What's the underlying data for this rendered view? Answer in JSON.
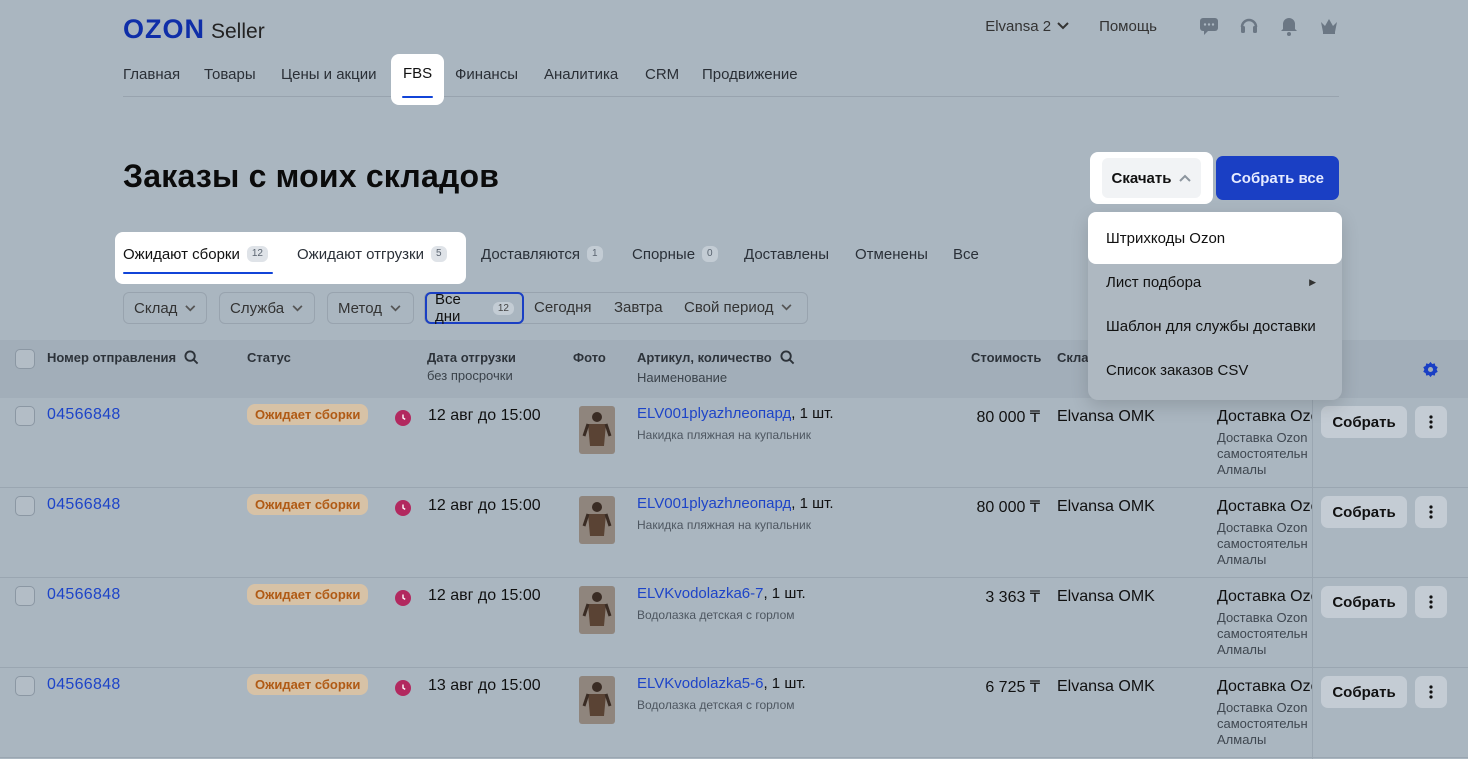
{
  "header": {
    "brand": "OZON",
    "product": "Seller",
    "account": "Elvansa 2",
    "help": "Помощь",
    "icons": [
      "chat-icon",
      "headset-icon",
      "bell-icon",
      "crown-icon"
    ]
  },
  "nav": {
    "items": [
      {
        "label": "Главная"
      },
      {
        "label": "Товары"
      },
      {
        "label": "Цены и акции"
      },
      {
        "label": "FBS",
        "active": true
      },
      {
        "label": "Финансы"
      },
      {
        "label": "Аналитика"
      },
      {
        "label": "CRM"
      },
      {
        "label": "Продвижение"
      }
    ]
  },
  "page": {
    "title": "Заказы с моих складов",
    "download_label": "Скачать",
    "collect_all_label": "Собрать все"
  },
  "download_menu": {
    "items": [
      {
        "label": "Штрихкоды Ozon"
      },
      {
        "label": "Лист подбора",
        "has_submenu": true
      },
      {
        "label": "Шаблон для службы доставки"
      },
      {
        "label": "Список заказов CSV"
      }
    ]
  },
  "status_tabs": [
    {
      "label": "Ожидают сборки",
      "count": "12",
      "selected": true
    },
    {
      "label": "Ожидают отгрузки",
      "count": "5"
    },
    {
      "label": "Доставляются",
      "count": "1"
    },
    {
      "label": "Спорные",
      "count": "0"
    },
    {
      "label": "Доставлены"
    },
    {
      "label": "Отменены"
    },
    {
      "label": "Все"
    }
  ],
  "filters": {
    "warehouse": "Склад",
    "service": "Служба",
    "method": "Метод",
    "all_days": "Все дни",
    "all_days_count": "12",
    "today": "Сегодня",
    "tomorrow": "Завтра",
    "custom_period": "Свой период"
  },
  "table": {
    "columns": {
      "order_no": "Номер отправления",
      "status": "Статус",
      "ship_date": "Дата отгрузки",
      "ship_date_sub": "без просрочки",
      "photo": "Фото",
      "sku": "Артикул, количество",
      "sku_sub": "Наименование",
      "price": "Стоимость",
      "warehouse": "Скла"
    },
    "rows": [
      {
        "order": "04566848",
        "status": "Ожидает сборки",
        "date": "12 авг до 15:00",
        "sku": "ELV001plyazhлеопард",
        "qty": ", 1 шт.",
        "name": "Накидка пляжная на купальник",
        "price": "80 000 ₸",
        "warehouse": "Elvansa OMK",
        "delivery": "Доставка Ozo",
        "delivery_l1": "Доставка Ozon",
        "delivery_l2": "самостоятельн",
        "delivery_l3": "Алмалы",
        "action": "Собрать"
      },
      {
        "order": "04566848",
        "status": "Ожидает сборки",
        "date": "12 авг до 15:00",
        "sku": "ELV001plyazhлеопард",
        "qty": ", 1 шт.",
        "name": "Накидка пляжная на купальник",
        "price": "80 000 ₸",
        "warehouse": "Elvansa OMK",
        "delivery": "Доставка Ozo",
        "delivery_l1": "Доставка Ozon",
        "delivery_l2": "самостоятельн",
        "delivery_l3": "Алмалы",
        "action": "Собрать"
      },
      {
        "order": "04566848",
        "status": "Ожидает сборки",
        "date": "12 авг до 15:00",
        "sku": "ELVKvodolazka6-7",
        "qty": ", 1 шт.",
        "name": "Водолазка детская с горлом",
        "price": "3 363 ₸",
        "warehouse": "Elvansa OMK",
        "delivery": "Доставка Ozo",
        "delivery_l1": "Доставка Ozon",
        "delivery_l2": "самостоятельн",
        "delivery_l3": "Алмалы",
        "action": "Собрать"
      },
      {
        "order": "04566848",
        "status": "Ожидает сборки",
        "date": "13 авг до 15:00",
        "sku": "ELVKvodolazka5-6",
        "qty": ", 1 шт.",
        "name": "Водолазка детская с горлом",
        "price": "6 725 ₸",
        "warehouse": "Elvansa OMK",
        "delivery": "Доставка Ozo",
        "delivery_l1": "Доставка Ozon",
        "delivery_l2": "самостоятельн",
        "delivery_l3": "Алмалы",
        "action": "Собрать"
      }
    ]
  },
  "colors": {
    "accent": "#1144d8",
    "button_primary": "#1a3fc4",
    "status_badge": "#b05a14"
  }
}
